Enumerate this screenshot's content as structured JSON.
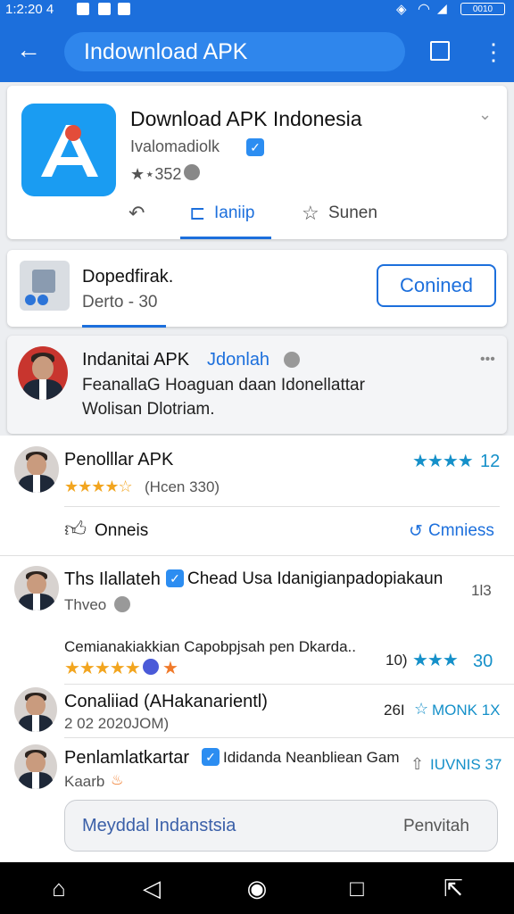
{
  "status_bar": {
    "time": "1:2:20 4",
    "battery": "0010"
  },
  "search": {
    "query": "Indownload APK"
  },
  "app_card": {
    "title": "Download APK Indonesia",
    "developer": "Ivalomadiolk",
    "rating_line": "★⋆352",
    "tabs": [
      {
        "icon": "share-back-icon",
        "label": ""
      },
      {
        "icon": "bookmark-icon",
        "label": "Ianiip"
      },
      {
        "icon": "star-outline-icon",
        "label": "Sunen"
      }
    ]
  },
  "promo_card": {
    "title": "Dopedfirak.",
    "subtitle": "Derto - 30",
    "button": "Conined"
  },
  "feed_header": {
    "name": "Indanitai APK",
    "tag": "Jdonlah",
    "line1": "FeanallaG Hoaguan daan Idonellattar",
    "line2": "Wolisan Dlotriam."
  },
  "reviews": [
    {
      "name": "Penolllar APK",
      "stars_text": "★★★★☆",
      "meta": "(Hcen 330)",
      "right_stars": "★★★★",
      "right_num": "12"
    },
    {
      "name": "Ths Ilallateh",
      "headline": "Chead Usa Idanigianpadopiakaun",
      "meta": "Thveo",
      "count": "1l3"
    },
    {
      "comment": "Cemianakiakkian Capobpjsah pen Dkarda..",
      "count": "10)",
      "right_stars": "★★★",
      "right_num": "30"
    },
    {
      "name": "Conaliiad (AHakanarientl)",
      "meta": "2 02 2020JOM)",
      "count": "26I",
      "right": "MONK 1X"
    },
    {
      "name": "Penlamlatkartar",
      "headline": "Ididanda Neanbliean Gam",
      "meta": "Kaarb",
      "right": "IUVNIS 37"
    }
  ],
  "like_row": {
    "like_label": "Onneis",
    "comments_label": "Cmniess"
  },
  "reply_box": {
    "placeholder": "Meyddal Indanstsia",
    "send": "Penvitah"
  },
  "colors": {
    "accent": "#1c6fdc",
    "star": "#f2a51f",
    "rating_blue": "#1590c9"
  }
}
